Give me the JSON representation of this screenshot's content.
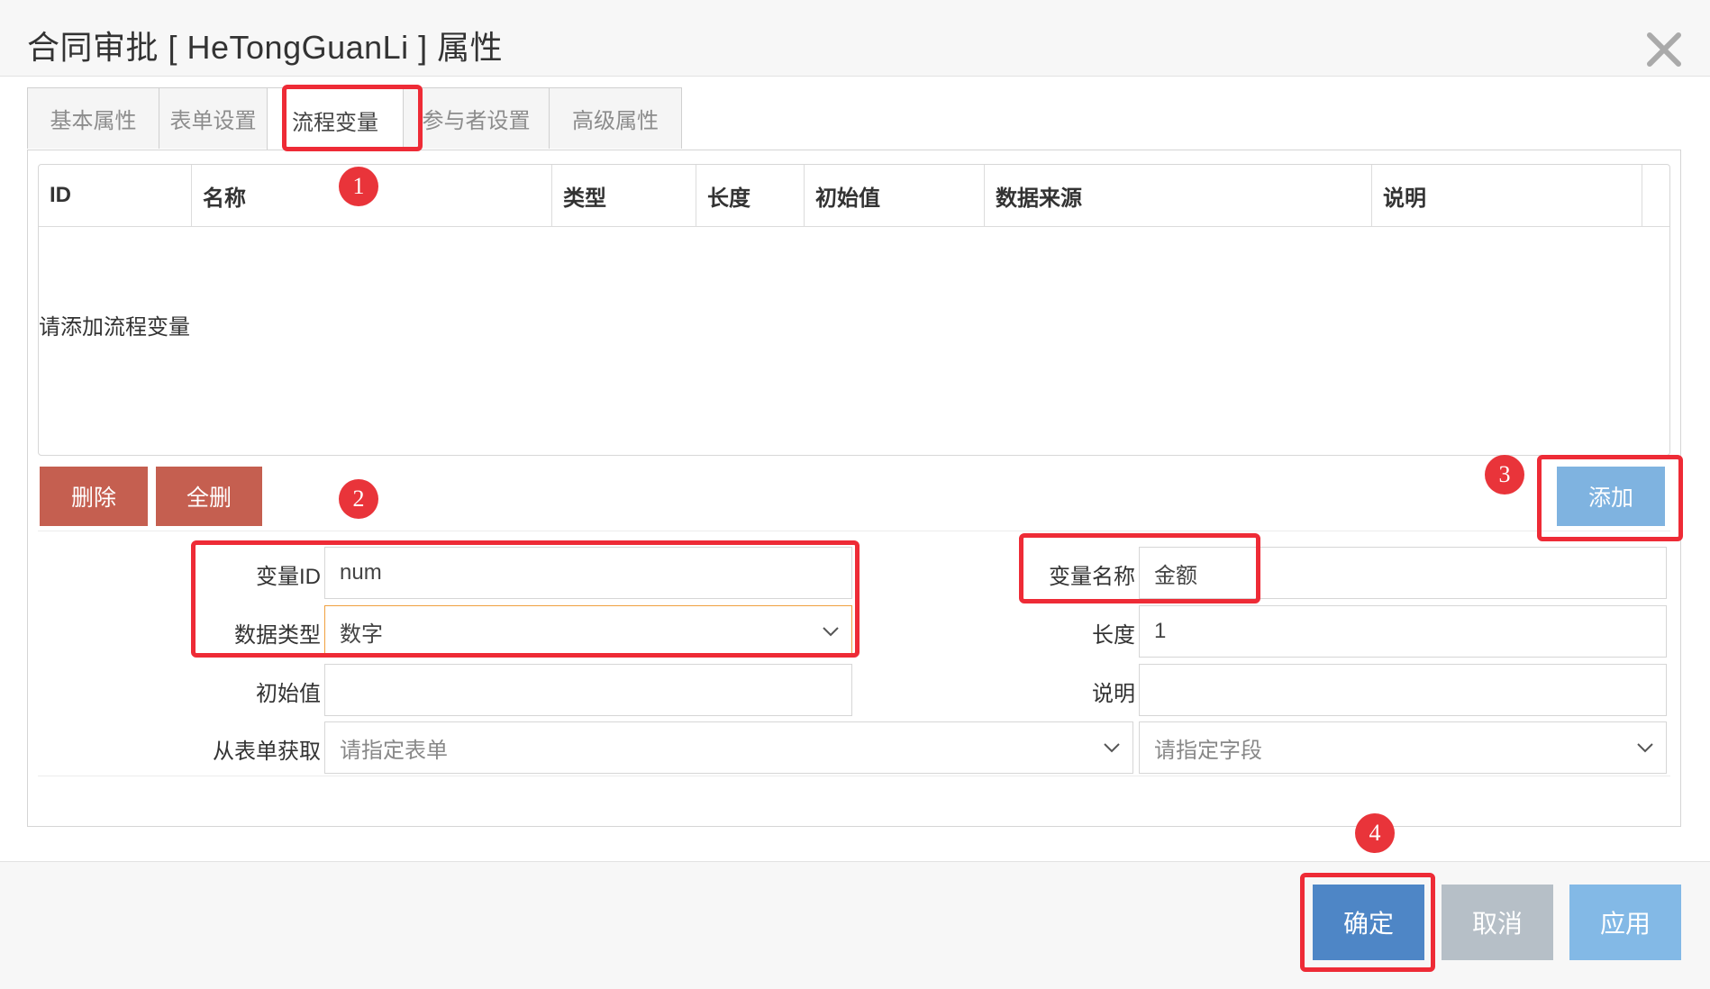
{
  "dialog": {
    "title": "合同审批 [ HeTongGuanLi ] 属性"
  },
  "tabs": [
    {
      "label": "基本属性"
    },
    {
      "label": "表单设置"
    },
    {
      "label": "流程变量",
      "active": true
    },
    {
      "label": "参与者设置"
    },
    {
      "label": "高级属性"
    }
  ],
  "grid": {
    "columns": [
      "ID",
      "名称",
      "类型",
      "长度",
      "初始值",
      "数据来源",
      "说明"
    ],
    "empty_text": "请添加流程变量"
  },
  "actions": {
    "delete_label": "删除",
    "delete_all_label": "全删",
    "add_label": "添加"
  },
  "form": {
    "var_id": {
      "label": "变量ID",
      "value": "num"
    },
    "var_name": {
      "label": "变量名称",
      "value": "金额"
    },
    "data_type": {
      "label": "数据类型",
      "value": "数字"
    },
    "length": {
      "label": "长度",
      "value": "1"
    },
    "init_value": {
      "label": "初始值",
      "value": ""
    },
    "description": {
      "label": "说明",
      "value": ""
    },
    "from_form": {
      "label": "从表单获取",
      "form_placeholder": "请指定表单",
      "field_placeholder": "请指定字段"
    }
  },
  "footer": {
    "ok_label": "确定",
    "cancel_label": "取消",
    "apply_label": "应用"
  },
  "annotations": [
    "1",
    "2",
    "3",
    "4"
  ],
  "colors": {
    "annotation": "#ee2b36",
    "danger_button": "#c55f50",
    "primary_button": "#4e86c6",
    "add_button": "#7fb3e0"
  }
}
